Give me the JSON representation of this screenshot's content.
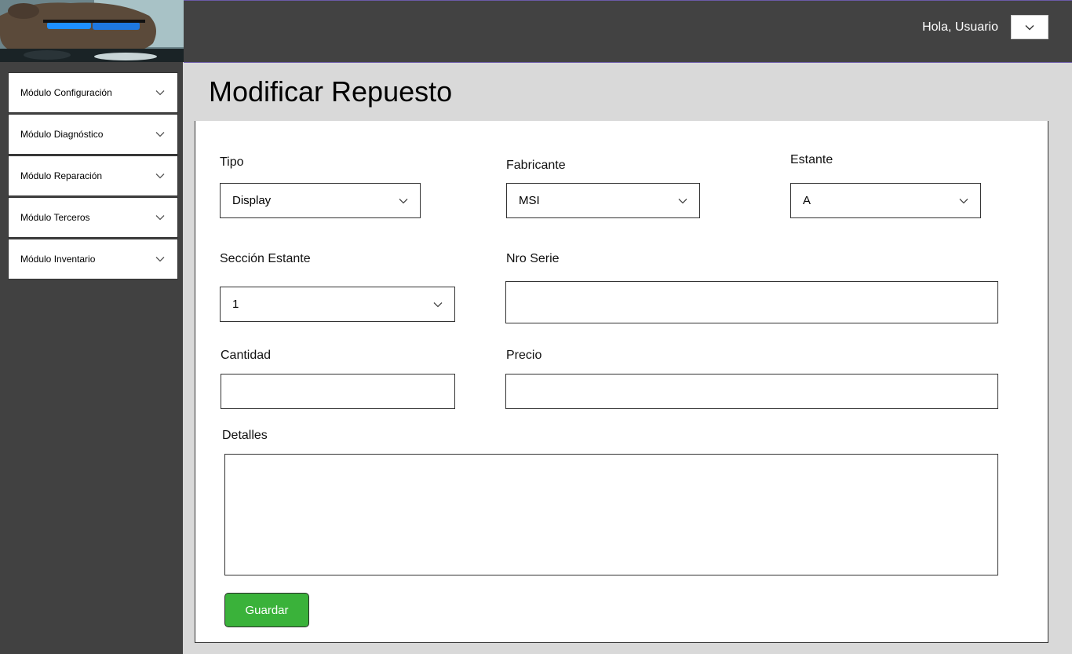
{
  "header": {
    "greeting": "Hola, Usuario",
    "user_menu_icon": "chevron-down-icon"
  },
  "sidebar": {
    "items": [
      {
        "label": "Módulo Configuración",
        "icon": "chevron-down-icon"
      },
      {
        "label": "Módulo Diagnóstico",
        "icon": "chevron-down-icon"
      },
      {
        "label": "Módulo Reparación",
        "icon": "chevron-down-icon"
      },
      {
        "label": "Módulo Terceros",
        "icon": "chevron-down-icon"
      },
      {
        "label": "Módulo Inventario",
        "icon": "chevron-down-icon"
      }
    ]
  },
  "page": {
    "title": "Modificar Repuesto"
  },
  "form": {
    "tipo": {
      "label": "Tipo",
      "value": "Display"
    },
    "fabricante": {
      "label": "Fabricante",
      "value": "MSI"
    },
    "estante": {
      "label": "Estante",
      "value": "A"
    },
    "seccion": {
      "label": "Sección Estante",
      "value": "1"
    },
    "nro_serie": {
      "label": "Nro Serie",
      "value": ""
    },
    "cantidad": {
      "label": "Cantidad",
      "value": ""
    },
    "precio": {
      "label": "Precio",
      "value": ""
    },
    "detalles": {
      "label": "Detalles",
      "value": ""
    },
    "save_label": "Guardar"
  },
  "colors": {
    "topbar": "#424242",
    "sidebar": "#414141",
    "save_button": "#3ab23a"
  }
}
